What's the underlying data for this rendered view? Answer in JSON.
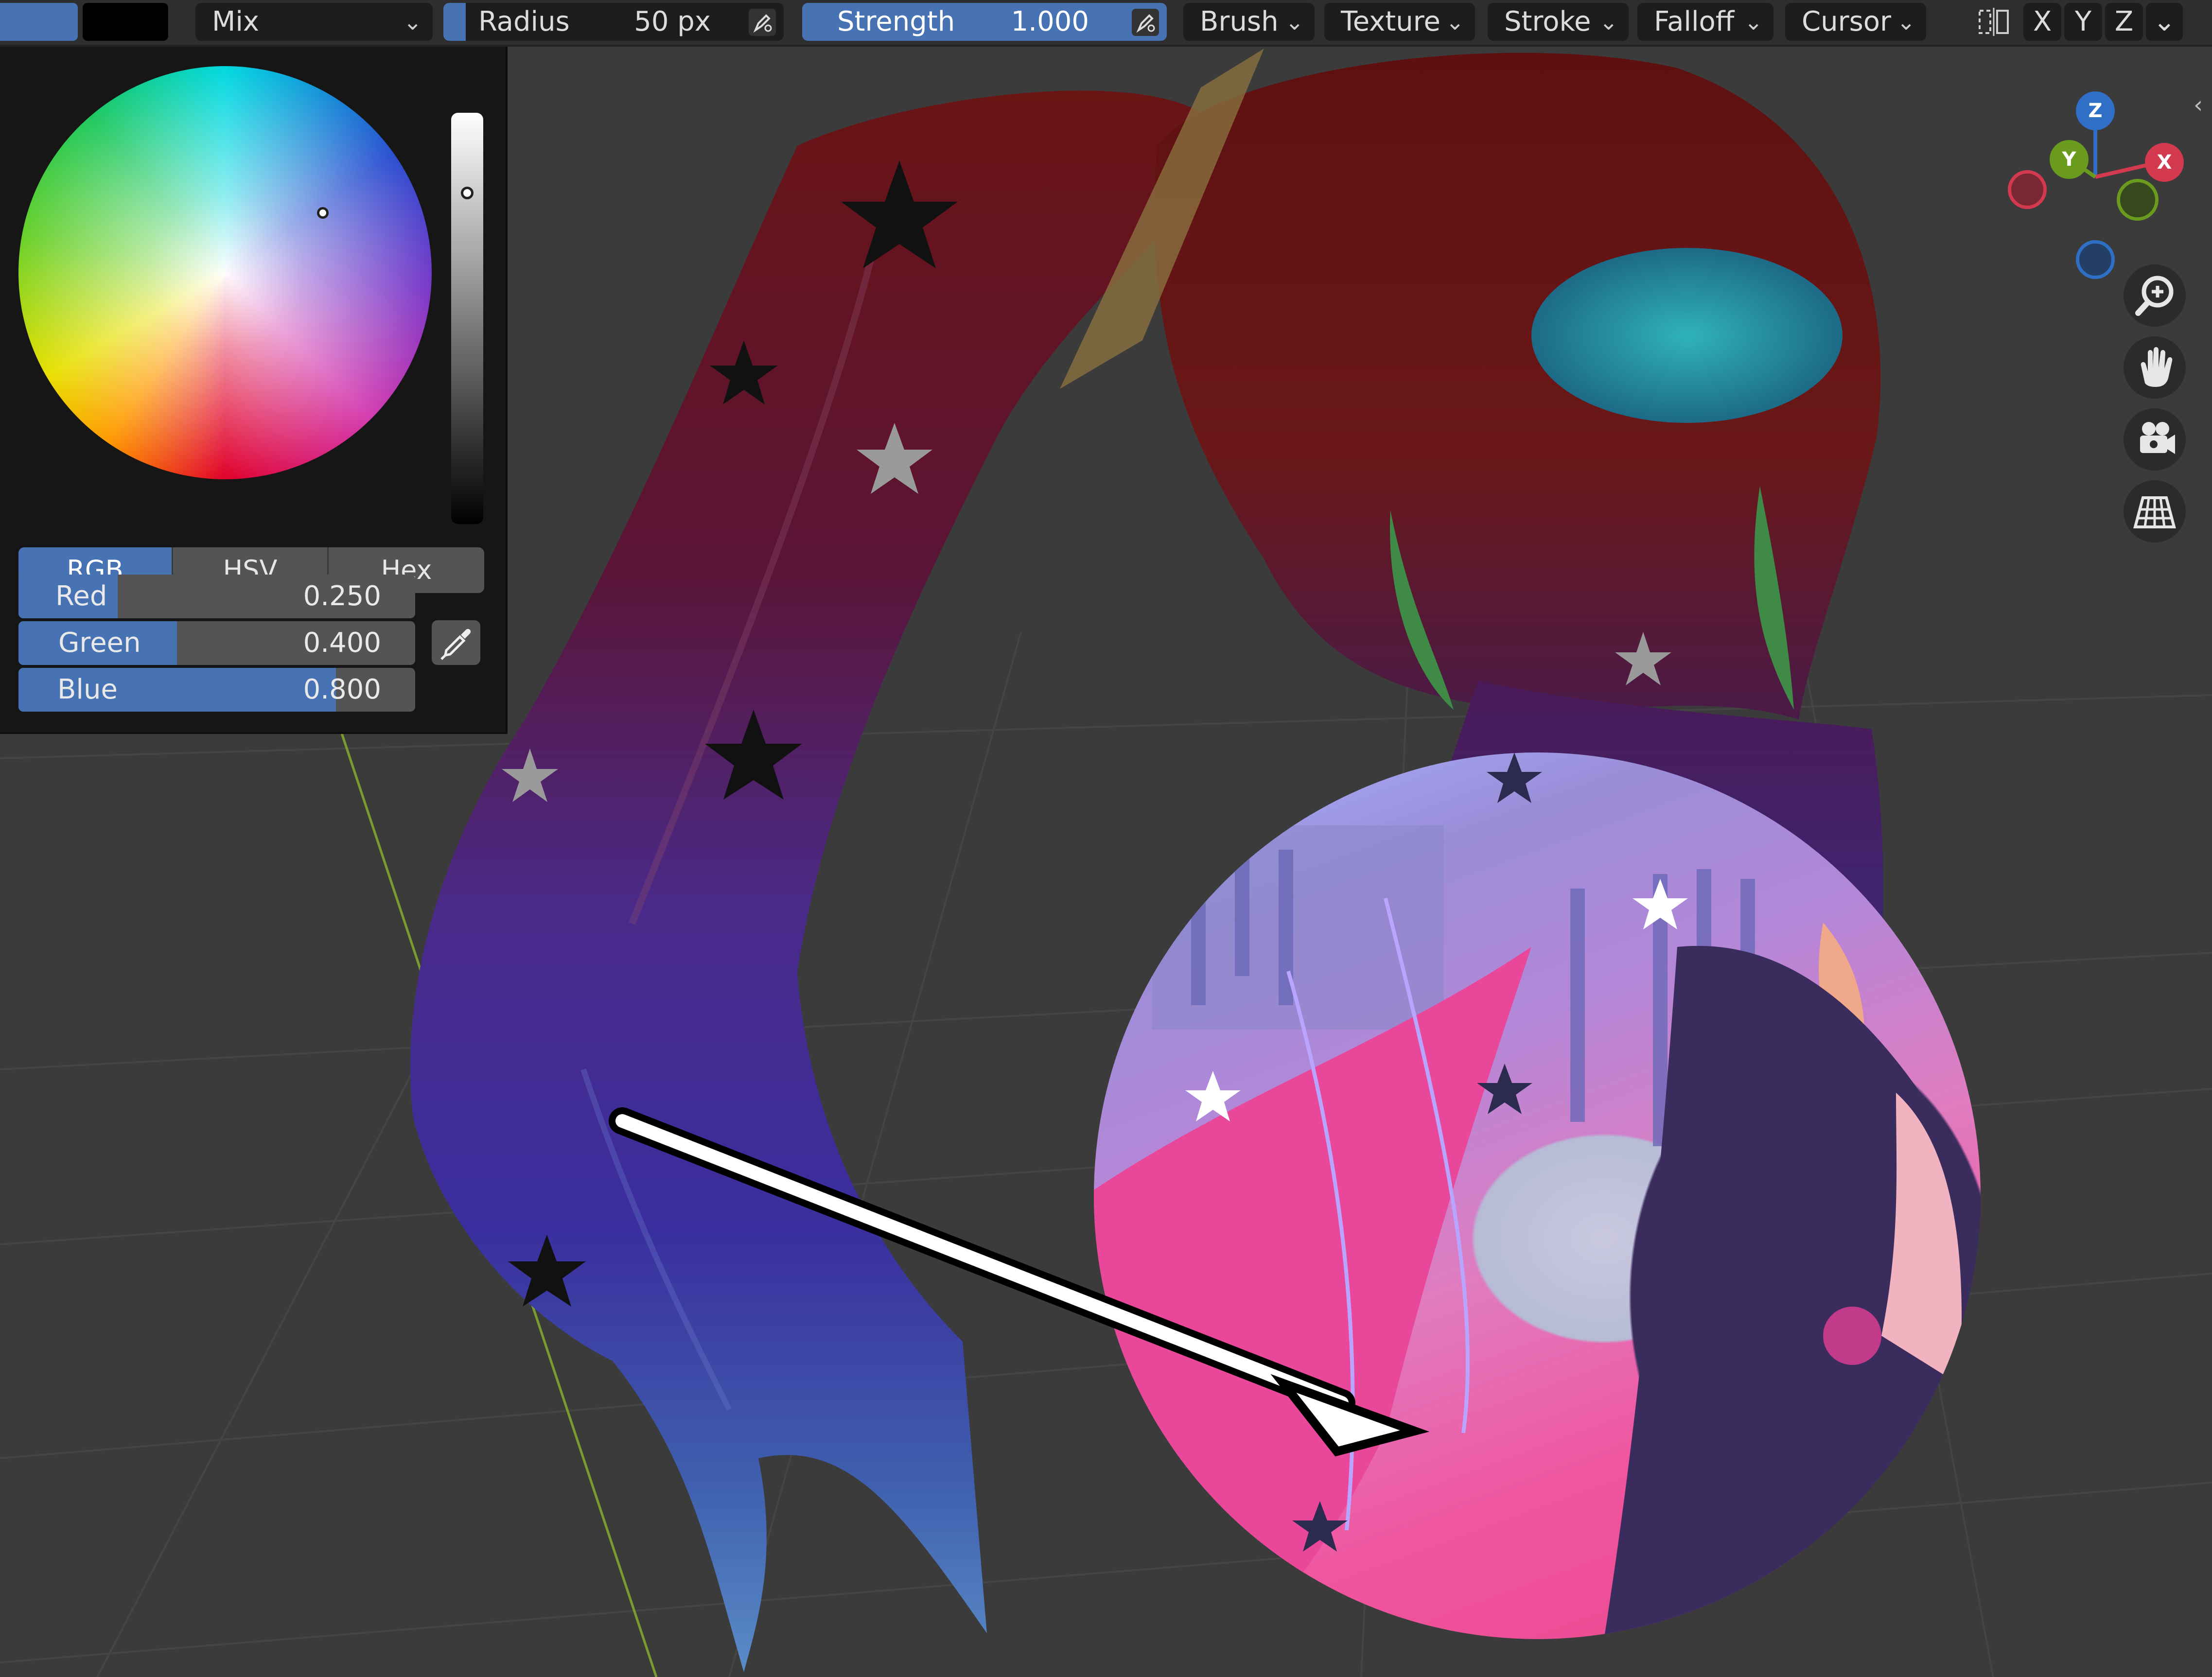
{
  "toolbar": {
    "blend_mode": "Mix",
    "radius_label": "Radius",
    "radius_value": "50 px",
    "strength_label": "Strength",
    "strength_value": "1.000",
    "brush_menu": "Brush",
    "texture_menu": "Texture",
    "stroke_menu": "Stroke",
    "falloff_menu": "Falloff",
    "cursor_menu": "Cursor",
    "axis_x": "X",
    "axis_y": "Y",
    "axis_z": "Z"
  },
  "color_panel": {
    "tabs": [
      {
        "label": "RGB",
        "active": true
      },
      {
        "label": "HSV",
        "active": false
      },
      {
        "label": "Hex",
        "active": false
      }
    ],
    "sliders": [
      {
        "name": "Red",
        "value": "0.250",
        "fill": 0.25
      },
      {
        "name": "Green",
        "value": "0.400",
        "fill": 0.4
      },
      {
        "name": "Blue",
        "value": "0.800",
        "fill": 0.8
      }
    ]
  },
  "gizmo": {
    "x_label": "X",
    "y_label": "Y",
    "z_label": "Z"
  },
  "colors": {
    "accent": "#4772b3",
    "panel_bg": "#161616",
    "viewport_bg": "#3b3b3b",
    "axis_x": "#d33a50",
    "axis_y": "#6b9b1e",
    "axis_z": "#2f6fc6"
  },
  "icons": {
    "zoom": "zoom-in-icon",
    "pan": "hand-icon",
    "camera": "camera-icon",
    "grid": "perspective-grid-icon"
  }
}
